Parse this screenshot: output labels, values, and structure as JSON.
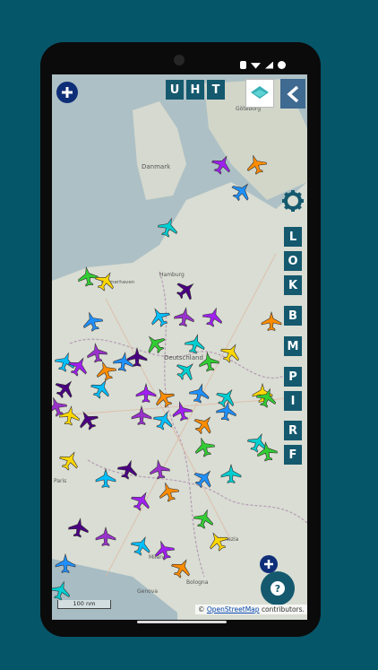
{
  "top_mode_buttons": [
    {
      "label": "U"
    },
    {
      "label": "H"
    },
    {
      "label": "T"
    }
  ],
  "side_filter_buttons": [
    {
      "label": "L"
    },
    {
      "label": "O"
    },
    {
      "label": "K"
    },
    {
      "label": "B"
    },
    {
      "label": "M"
    },
    {
      "label": "P"
    },
    {
      "label": "I"
    },
    {
      "label": "R"
    },
    {
      "label": "F"
    }
  ],
  "map": {
    "scale_label": "100 nm",
    "attribution_prefix": "©",
    "attribution_link": "OpenStreetMap",
    "attribution_suffix": "contributors.",
    "place_labels": [
      "Göteborg",
      "Danmark",
      "Hamburg",
      "Bremerhaven",
      "Deutschland",
      "Bologna",
      "Genova",
      "Milano",
      "Venezia",
      "Paris"
    ]
  },
  "colors": {
    "accent": "#14596e",
    "dark_blue": "#0f2e78",
    "background": "#06566a"
  },
  "aircraft_colors": [
    "#a020f0",
    "#ff8c00",
    "#1e90ff",
    "#00ced1",
    "#32cd32",
    "#ffd700",
    "#4b0082",
    "#9932cc",
    "#00bfff"
  ],
  "icons": [
    "add-icon",
    "layers-icon",
    "back-chevron-icon",
    "gear-icon",
    "help-icon",
    "add-icon-bottom"
  ]
}
